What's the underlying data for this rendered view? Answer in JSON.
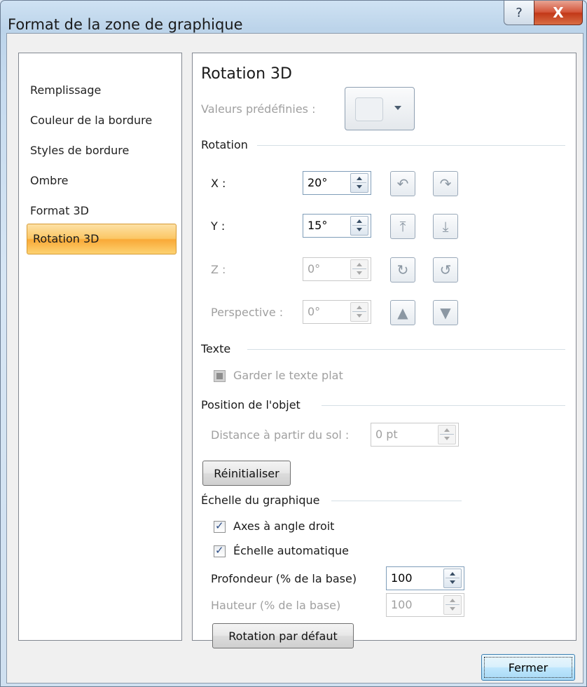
{
  "window": {
    "title": "Format de la zone de graphique",
    "help_icon": "?",
    "close_icon": "X"
  },
  "nav": {
    "items": [
      "Remplissage",
      "Couleur de la bordure",
      "Styles de bordure",
      "Ombre",
      "Format 3D"
    ],
    "selected": "Rotation 3D"
  },
  "panel": {
    "heading": "Rotation 3D",
    "presets_label": "Valeurs prédéfinies :",
    "rotation_section": "Rotation",
    "x": {
      "label": "X :",
      "value": "20°"
    },
    "y": {
      "label": "Y :",
      "value": "15°"
    },
    "z": {
      "label": "Z :",
      "value": "0°"
    },
    "perspective": {
      "label": "Perspective :",
      "value": "0°"
    },
    "text_section": "Texte",
    "keep_text_flat": {
      "label": "Garder le texte plat",
      "checked": false,
      "enabled": false
    },
    "object_position_section": "Position de l'objet",
    "distance": {
      "label": "Distance à partir du sol :",
      "value": "0 pt"
    },
    "reset_button": "Réinitialiser",
    "scale_section": "Échelle du graphique",
    "right_angle_axes": {
      "label": "Axes à angle droit",
      "checked": true
    },
    "autoscale": {
      "label": "Échelle automatique",
      "checked": true
    },
    "depth": {
      "label": "Profondeur (% de la base)",
      "value": "100"
    },
    "height": {
      "label": "Hauteur (% de la base)",
      "value": "100"
    },
    "default_rotation_button": "Rotation par défaut"
  },
  "footer": {
    "close_button": "Fermer"
  }
}
